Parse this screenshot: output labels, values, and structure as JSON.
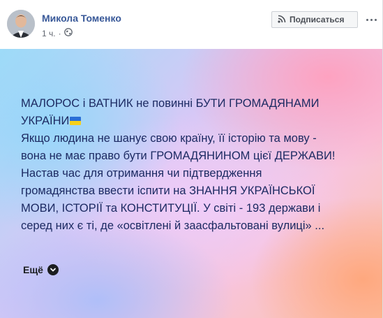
{
  "post": {
    "author": "Микола Томенко",
    "time": "1 ч.",
    "separator": "·",
    "subscribe_label": "Подписаться",
    "text_lines": [
      "МАЛОРОС і ВАТНИК не повинні БУТИ ГРОМАДЯНАМИ",
      "УКРАЇНИ",
      "Якщо людина не шанує свою країну, її історію та мову -",
      "вона не має право бути ГРОМАДЯНИНОМ цієї ДЕРЖАВИ!",
      "Настав час для отримання чи підтвердження",
      "громадянства ввести іспити на ЗНАННЯ УКРАЇНСЬКОЇ",
      "МОВИ, ІСТОРІЇ та КОНСТИТУЦІЇ. У світі - 193 держави і",
      "серед них є ті, де «освітлені й заасфальтовані вулиці» ..."
    ],
    "more_label": "Ещё"
  },
  "icons": {
    "privacy": "globe-icon",
    "subscribe": "rss-icon",
    "more": "chevron-down-icon",
    "options": "more-options-icon",
    "flag": "ukraine-flag-icon"
  },
  "colors": {
    "author_link": "#385898",
    "post_text": "#1c2a62",
    "meta_text": "#616770",
    "flag_blue": "#2a6fd6",
    "flag_yellow": "#f7d01a"
  }
}
